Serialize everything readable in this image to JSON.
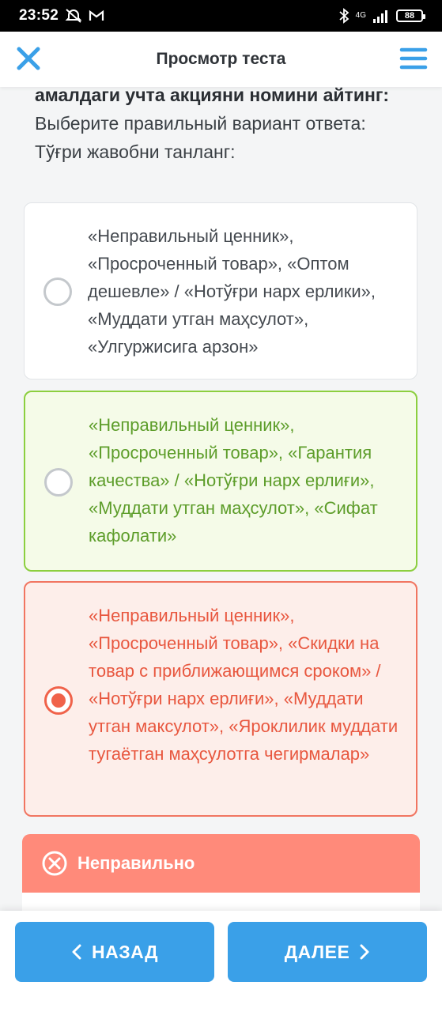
{
  "status_bar": {
    "time": "23:52",
    "network": "4G",
    "battery": "88"
  },
  "header": {
    "title": "Просмотр теста"
  },
  "question": {
    "line1": "амалдаги учта акцияни номини айтинг:",
    "line2": "Выберите правильный вариант ответа:",
    "line3": "Тўғри жавобни танланг:"
  },
  "options": [
    {
      "text": "«Неправильный ценник», «Просроченный товар», «Оптом дешевле» / «Нотўғри нарх ерлики», «Муддати утган маҳсулот», «Улгуржисига арзон»",
      "state": "unselected"
    },
    {
      "text": "«Неправильный ценник», «Просроченный товар», «Гарантия качества» / «Нотўғри нарх ерлиғи», «Муддати утган маҳсулот», «Сифат кафолати»",
      "state": "correct"
    },
    {
      "text": "«Неправильный ценник», «Просроченный товар», «Скидки на товар с приближающимся сроком» / «Нотўғри нарх ерлиғи», «Муддати утган максулот», «Яроклилик муддати тугаётган маҳсулотга чегирмалар»",
      "state": "selected-wrong"
    }
  ],
  "result": {
    "label": "Неправильно",
    "color": "#ff8a7a"
  },
  "nav": {
    "back_label": "НАЗАД",
    "next_label": "ДАЛЕЕ"
  },
  "colors": {
    "accent": "#3aa0e8",
    "correct": "#5d9d2a",
    "wrong": "#e8573f"
  }
}
